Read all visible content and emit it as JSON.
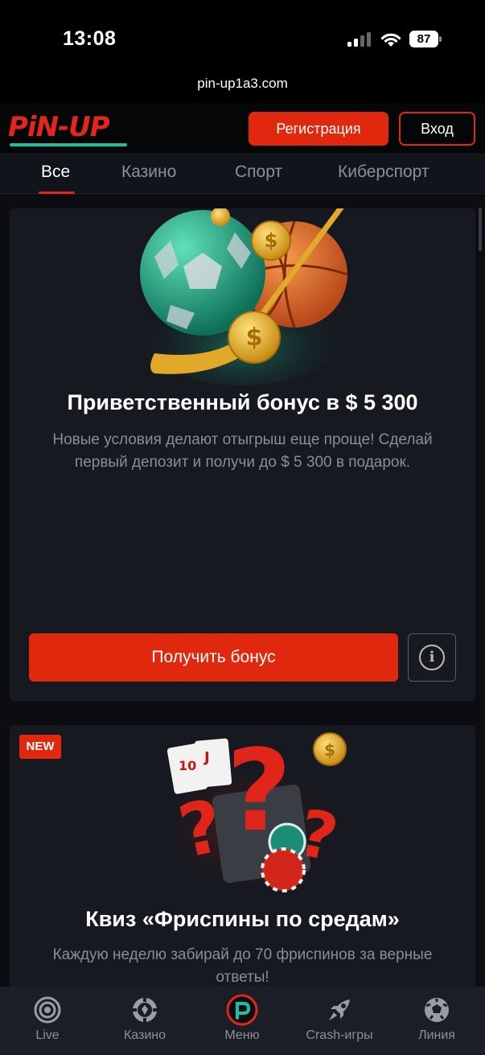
{
  "status_bar": {
    "time": "13:08",
    "battery": "87"
  },
  "browser": {
    "url": "pin-up1a3.com"
  },
  "header": {
    "logo_text": "PiN-UP",
    "register_label": "Регистрация",
    "login_label": "Вход"
  },
  "tabs": [
    {
      "label": "Все"
    },
    {
      "label": "Казино"
    },
    {
      "label": "Спорт"
    },
    {
      "label": "Киберспорт"
    }
  ],
  "active_tab": "Все",
  "promo_cards": [
    {
      "title": "Приветственный бонус в $ 5 300",
      "description": "Новые условия делают отыгрыш еще проще! Сделай первый депозит и получи до $ 5 300 в подарок.",
      "cta_label": "Получить бонус",
      "image_icon": "sports-balls-coins-image"
    },
    {
      "badge": "NEW",
      "title": "Квиз «Фриспины по средам»",
      "description": "Каждую неделю забирай до 70 фриспинов за верные ответы!",
      "image_icon": "question-marks-cards-chips-image"
    }
  ],
  "bottom_nav": [
    {
      "label": "Live",
      "icon": "live-icon"
    },
    {
      "label": "Казино",
      "icon": "casino-chip-icon"
    },
    {
      "label": "Меню",
      "icon": "pinup-logo-icon"
    },
    {
      "label": "Crash-игры",
      "icon": "rocket-icon"
    },
    {
      "label": "Линия",
      "icon": "soccer-ball-icon"
    }
  ],
  "colors": {
    "accent": "#e0280f",
    "logo_underline": "#1fbf9b",
    "card_bg": "#161920",
    "page_bg": "#0b0d12"
  }
}
